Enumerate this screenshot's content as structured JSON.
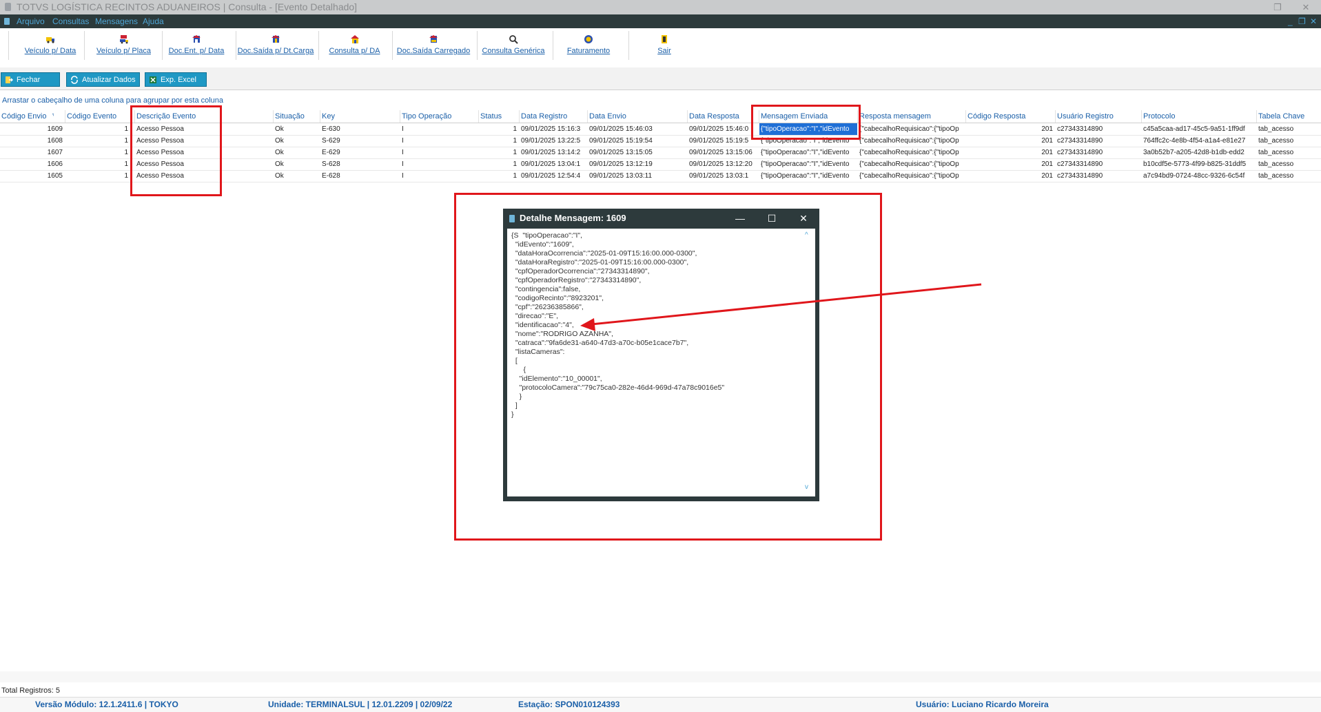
{
  "window": {
    "title": "TOTVS LOGÍSTICA RECINTOS ADUANEIROS | Consulta - [Evento Detalhado]",
    "restore_glyph": "❐",
    "close_glyph": "✕"
  },
  "menu": {
    "items": [
      "Arquivo",
      "Consultas",
      "Mensagens",
      "Ajuda"
    ],
    "minimize_glyph": "_",
    "restore_glyph": "❐",
    "close_glyph": "✕"
  },
  "toolbar": {
    "buttons": [
      {
        "label": "Veículo p/ Data",
        "icon": "truck-icon"
      },
      {
        "label": "Veículo p/ Placa",
        "icon": "truck-plate-icon"
      },
      {
        "label": "Doc.Ent. p/ Data",
        "icon": "doc-entry-icon"
      },
      {
        "label": "Doc.Saída p/ Dt.Carga",
        "icon": "doc-exit-icon"
      },
      {
        "label": "Consulta p/ DA",
        "icon": "query-da-icon"
      },
      {
        "label": "Doc.Saída Carregado",
        "icon": "doc-loaded-icon"
      },
      {
        "label": "Consulta Genérica",
        "icon": "magnifier-icon"
      },
      {
        "label": "Faturamento",
        "icon": "billing-icon"
      },
      {
        "label": "Sair",
        "icon": "exit-door-icon"
      }
    ]
  },
  "actions": {
    "close_label": "Fechar",
    "refresh_label": "Atualizar Dados",
    "export_label": "Exp. Excel"
  },
  "grid": {
    "group_hint": "Arrastar o cabeçalho de uma coluna para agrupar por esta coluna",
    "sort_glyph": "▽",
    "columns": [
      "Código Envio",
      "Código Evento",
      "Descrição Evento",
      "Situação",
      "Key",
      "Tipo Operação",
      "Status",
      "Data Registro",
      "Data Envio",
      "Data Resposta",
      "Mensagem Enviada",
      "Resposta mensagem",
      "Código Resposta",
      "Usuário Registro",
      "Protocolo",
      "Tabela Chave"
    ],
    "rows": [
      {
        "codigo_envio": "1609",
        "codigo_evento": "1",
        "descricao": "Acesso Pessoa",
        "situacao": "Ok",
        "key": "E-630",
        "tipo": "I",
        "status": "1",
        "data_registro": "09/01/2025 15:16:3",
        "data_envio": "09/01/2025 15:46:03",
        "data_resposta": "09/01/2025 15:46:0",
        "mensagem": "{\"tipoOperacao\":\"I\",\"idEvento",
        "resposta": "{\"cabecalhoRequisicao\":{\"tipoOp",
        "codigo_resposta": "201",
        "usuario": "c27343314890",
        "protocolo": "c45a5caa-ad17-45c5-9a51-1ff9df",
        "tabela": "tab_acesso"
      },
      {
        "codigo_envio": "1608",
        "codigo_evento": "1",
        "descricao": "Acesso Pessoa",
        "situacao": "Ok",
        "key": "S-629",
        "tipo": "I",
        "status": "1",
        "data_registro": "09/01/2025 13:22:5",
        "data_envio": "09/01/2025 15:19:54",
        "data_resposta": "09/01/2025 15:19:5",
        "mensagem": "{\"tipoOperacao\":\"I\",\"idEvento",
        "resposta": "{\"cabecalhoRequisicao\":{\"tipoOp",
        "codigo_resposta": "201",
        "usuario": "c27343314890",
        "protocolo": "764ffc2c-4e8b-4f54-a1a4-e81e27",
        "tabela": "tab_acesso"
      },
      {
        "codigo_envio": "1607",
        "codigo_evento": "1",
        "descricao": "Acesso Pessoa",
        "situacao": "Ok",
        "key": "E-629",
        "tipo": "I",
        "status": "1",
        "data_registro": "09/01/2025 13:14:2",
        "data_envio": "09/01/2025 13:15:05",
        "data_resposta": "09/01/2025 13:15:06",
        "mensagem": "{\"tipoOperacao\":\"I\",\"idEvento",
        "resposta": "{\"cabecalhoRequisicao\":{\"tipoOp",
        "codigo_resposta": "201",
        "usuario": "c27343314890",
        "protocolo": "3a0b52b7-a205-42d8-b1db-edd2",
        "tabela": "tab_acesso"
      },
      {
        "codigo_envio": "1606",
        "codigo_evento": "1",
        "descricao": "Acesso Pessoa",
        "situacao": "Ok",
        "key": "S-628",
        "tipo": "I",
        "status": "1",
        "data_registro": "09/01/2025 13:04:1",
        "data_envio": "09/01/2025 13:12:19",
        "data_resposta": "09/01/2025 13:12:20",
        "mensagem": "{\"tipoOperacao\":\"I\",\"idEvento",
        "resposta": "{\"cabecalhoRequisicao\":{\"tipoOp",
        "codigo_resposta": "201",
        "usuario": "c27343314890",
        "protocolo": "b10cdf5e-5773-4f99-b825-31ddf5",
        "tabela": "tab_acesso"
      },
      {
        "codigo_envio": "1605",
        "codigo_evento": "1",
        "descricao": "Acesso Pessoa",
        "situacao": "Ok",
        "key": "E-628",
        "tipo": "I",
        "status": "1",
        "data_registro": "09/01/2025 12:54:4",
        "data_envio": "09/01/2025 13:03:11",
        "data_resposta": "09/01/2025 13:03:1",
        "mensagem": "{\"tipoOperacao\":\"I\",\"idEvento",
        "resposta": "{\"cabecalhoRequisicao\":{\"tipoOp",
        "codigo_resposta": "201",
        "usuario": "c27343314890",
        "protocolo": "a7c94bd9-0724-48cc-9326-6c54f",
        "tabela": "tab_acesso"
      }
    ]
  },
  "dialog": {
    "title": "Detalhe Mensagem:  1609",
    "minimize_glyph": "—",
    "maximize_glyph": "☐",
    "close_glyph": "✕",
    "scroll_up_glyph": "^",
    "scroll_down_glyph": "v",
    "content": "{S  \"tipoOperacao\":\"I\",\n  \"idEvento\":\"1609\",\n  \"dataHoraOcorrencia\":\"2025-01-09T15:16:00.000-0300\",\n  \"dataHoraRegistro\":\"2025-01-09T15:16:00.000-0300\",\n  \"cpfOperadorOcorrencia\":\"27343314890\",\n  \"cpfOperadorRegistro\":\"27343314890\",\n  \"contingencia\":false,\n  \"codigoRecinto\":\"8923201\",\n  \"cpf\":\"26236385866\",\n  \"direcao\":\"E\",\n  \"identificacao\":\"4\",\n  \"nome\":\"RODRIGO AZANHA\",\n  \"catraca\":\"9fa6de31-a640-47d3-a70c-b05e1cace7b7\",\n  \"listaCameras\":\n  [\n      {\n    \"idElemento\":\"10_00001\",\n    \"protocoloCamera\":\"79c75ca0-282e-46d4-969d-47a78c9016e5\"\n    }\n  ]\n}"
  },
  "footer": {
    "total": "Total Registros:  5",
    "version": "Versão Módulo:  12.1.2411.6  |  TOKYO",
    "unit": "Unidade:  TERMINALSUL | 12.01.2209 | 02/09/22",
    "station": "Estação:  SPON010124393",
    "user": "Usuário:  Luciano Ricardo Moreira"
  },
  "colors": {
    "accent": "#1f98c4",
    "link": "#1a5fa8",
    "highlight": "#e0161b",
    "selection": "#1f6fd6"
  }
}
